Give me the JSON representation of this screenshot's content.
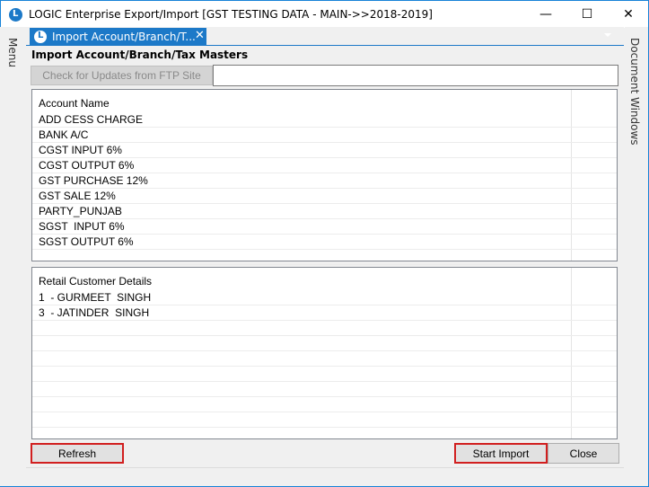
{
  "window": {
    "title": "LOGIC Enterprise Export/Import  [GST TESTING DATA - MAIN->>2018-2019]",
    "controls": {
      "minimize": "—",
      "maximize": "☐",
      "close": "✕"
    },
    "accent_color": "#1c79c8"
  },
  "side_panels": {
    "left": "Menu",
    "right": "Document Windows"
  },
  "tab": {
    "label": "Import Account/Branch/T...",
    "close": "✕"
  },
  "section": {
    "title": "Import Account/Branch/Tax Masters"
  },
  "ftp": {
    "button_label": "Check for Updates from FTP Site",
    "status_text": ""
  },
  "accounts": {
    "header": "Account Name",
    "rows": [
      "ADD CESS CHARGE",
      "BANK A/C",
      "CGST INPUT 6%",
      "CGST OUTPUT 6%",
      "GST PURCHASE 12%",
      "GST SALE 12%",
      "PARTY_PUNJAB",
      "SGST  INPUT 6%",
      "SGST OUTPUT 6%",
      ""
    ]
  },
  "customers": {
    "header": "Retail Customer Details",
    "rows": [
      "1  - GURMEET  SINGH",
      "3  - JATINDER  SINGH",
      "",
      "",
      "",
      "",
      "",
      "",
      "",
      ""
    ]
  },
  "buttons": {
    "refresh": "Refresh",
    "start_import": "Start Import",
    "close": "Close"
  },
  "highlight_color": "#d11f1f"
}
